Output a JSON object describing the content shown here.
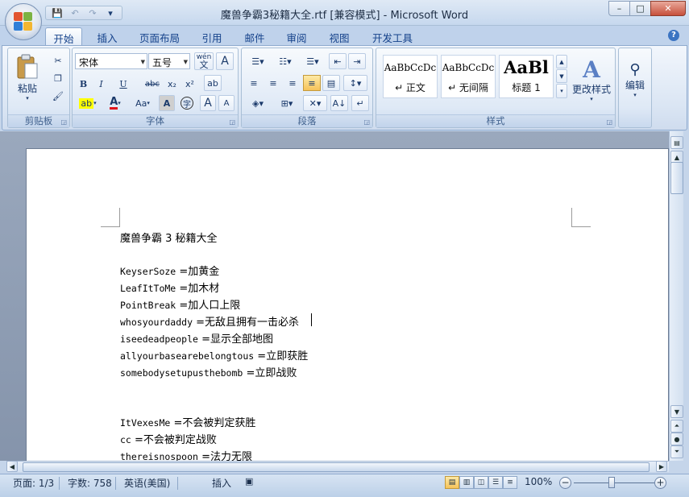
{
  "window": {
    "title": "魔兽争霸3秘籍大全.rtf [兼容模式] - Microsoft Word",
    "controls": {
      "minimize": "–",
      "maximize": "□",
      "close": "✕"
    }
  },
  "qat": {
    "save": "💾",
    "undo": "↶",
    "redo": "↷",
    "more": "▾"
  },
  "tabs": [
    "开始",
    "插入",
    "页面布局",
    "引用",
    "邮件",
    "审阅",
    "视图",
    "开发工具"
  ],
  "help": "?",
  "ribbon": {
    "clipboard": {
      "label": "剪贴板",
      "paste": "粘贴"
    },
    "font": {
      "label": "字体",
      "name": "宋体",
      "size": "五号",
      "wen": "wén",
      "buttons": {
        "bold": "B",
        "italic": "I",
        "underline": "U",
        "strike": "abc",
        "sub": "x₂",
        "sup": "x²",
        "font_color": "A",
        "case": "Aa",
        "shade": "A",
        "circle": "字",
        "grow": "A",
        "shrink": "A"
      }
    },
    "paragraph": {
      "label": "段落"
    },
    "styles": {
      "label": "样式",
      "items": [
        {
          "sample": "AaBbCcDc",
          "name": "↵ 正文"
        },
        {
          "sample": "AaBbCcDc",
          "name": "↵ 无间隔"
        },
        {
          "sample": "AaBl",
          "name": "标题 1"
        }
      ],
      "change_styles": "更改样式"
    },
    "editing": {
      "label": "编辑"
    }
  },
  "document": {
    "title": "魔兽争霸 3 秘籍大全",
    "cheats": [
      {
        "code": "KeyserSoze",
        "effect": " =加黄金"
      },
      {
        "code": "LeafItToMe",
        "effect": " =加木材"
      },
      {
        "code": "PointBreak",
        "effect": " =加人口上限"
      },
      {
        "code": "whosyourdaddy",
        "effect": " =无敌且拥有一击必杀"
      },
      {
        "code": "iseedeadpeople",
        "effect": " =显示全部地图"
      },
      {
        "code": "allyourbasearebelongtous",
        "effect": " =立即获胜"
      },
      {
        "code": "somebodysetupusthebomb",
        "effect": " =立即战败"
      },
      {
        "code": "ItVexesMe",
        "effect": " =不会被判定获胜"
      },
      {
        "code": "cc",
        "effect": " =不会被判定战败"
      },
      {
        "code": "thereisnospoon",
        "effect": " =法力无限"
      }
    ]
  },
  "statusbar": {
    "page": "页面: 1/3",
    "words": "字数: 758",
    "language": "英语(美国)",
    "mode": "插入",
    "zoom": "100%"
  }
}
